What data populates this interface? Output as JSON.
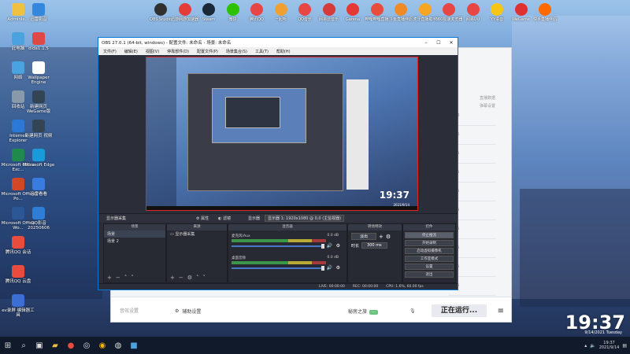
{
  "desktop": {
    "left_icons": [
      {
        "label": "Adminis...",
        "color": "#f0c040"
      },
      {
        "label": "此电脑",
        "color": "#4aa3df"
      },
      {
        "label": "网络",
        "color": "#4aa3df"
      },
      {
        "label": "回收站",
        "color": "#8899aa"
      },
      {
        "label": "Internet Explorer",
        "color": "#2b78d6"
      },
      {
        "label": "Microsoft Office Exc...",
        "color": "#1f8a4c"
      },
      {
        "label": "Microsoft Office Po...",
        "color": "#d24726"
      },
      {
        "label": "Microsoft Office Wo...",
        "color": "#2b5797"
      },
      {
        "label": "腾讯QQ 会话",
        "color": "#e94b3c"
      },
      {
        "label": "腾讯QQ 云盘",
        "color": "#e94b3c"
      },
      {
        "label": "ev录屏 编辑器工具",
        "color": "#3b6fd6"
      }
    ],
    "second_col_icons": [
      {
        "label": "迅雷影音",
        "color": "#3388dd"
      },
      {
        "label": "dida1.1.5",
        "color": "#e04848"
      },
      {
        "label": "Wallpaper Engine",
        "color": "#ffffff"
      },
      {
        "label": "新建网页 WeGame版",
        "color": "#334455"
      },
      {
        "label": "新建网页 视频",
        "color": "#334455"
      },
      {
        "label": "Microsoft Edge",
        "color": "#1a9ad8"
      },
      {
        "label": "迅雷看看",
        "color": "#3a7be0"
      },
      {
        "label": "QQ影音 20250606",
        "color": "#2e7dd7"
      }
    ],
    "top_icons": [
      {
        "label": "OBS Studio",
        "color": "#303030"
      },
      {
        "label": "迅游网游加速器",
        "color": "#e43b3b"
      },
      {
        "label": "Steam",
        "color": "#1b2838"
      },
      {
        "label": "微信",
        "color": "#2dc100"
      },
      {
        "label": "腾讯QQ",
        "color": "#e84545"
      },
      {
        "label": "一起听",
        "color": "#f0a030"
      },
      {
        "label": "QQ音乐",
        "color": "#e84545"
      },
      {
        "label": "网易云音乐",
        "color": "#d63a3a"
      },
      {
        "label": "Garena",
        "color": "#e53935"
      },
      {
        "label": "哔哩哔哩直播",
        "color": "#e94b3c"
      },
      {
        "label": "斗鱼直播伴侣",
        "color": "#f08a24"
      },
      {
        "label": "虎牙直播助手",
        "color": "#f6a623"
      },
      {
        "label": "360极速浏览器",
        "color": "#e84545"
      },
      {
        "label": "网易UU",
        "color": "#e84545"
      },
      {
        "label": "YY语音",
        "color": "#f5c518"
      },
      {
        "label": "WeGame",
        "color": "#e03131"
      },
      {
        "label": "快手直播伴侣",
        "color": "#ff6a00"
      }
    ]
  },
  "obs": {
    "title": "OBS 27.0.1 (64-bit, windows) - 配置文件: 未命名 - 场景: 未命名",
    "menu": [
      "文件(F)",
      "编辑(E)",
      "视图(V)",
      "停靠部件(D)",
      "配置文件(P)",
      "场景集合(S)",
      "工具(T)",
      "帮助(H)"
    ],
    "preview": {
      "clock": "19:37",
      "date": "2021/9/14"
    },
    "context_bar": {
      "scene_label": "显示器采集",
      "properties": "属性",
      "filters": "滤镜",
      "display_label": "显示器",
      "display_value": "显示器 1: 1920x1080 @ 0,0 (主监视器)"
    },
    "docks": {
      "scenes": {
        "header": "场景",
        "items": [
          "场景",
          "场景 2"
        ]
      },
      "sources": {
        "header": "来源",
        "items": [
          "显示器采集"
        ]
      },
      "mixer": {
        "header": "混音器",
        "tracks": [
          {
            "name": "麦克风/Aux",
            "db": "0.0 dB"
          },
          {
            "name": "桌面音频",
            "db": "0.0 dB"
          }
        ]
      },
      "transitions": {
        "header": "转场特效",
        "type": "淡出",
        "duration_label": "时长",
        "duration_value": "300 ms"
      },
      "controls": {
        "header": "控件",
        "buttons": [
          "停止推流",
          "开始录制",
          "启动虚拟摄像机",
          "工作室模式",
          "设置",
          "退出"
        ]
      }
    },
    "status": {
      "live": "LIVE: 00:00:00",
      "rec": "REC: 00:00:00",
      "cpu": "CPU: 1.6%, 60.00 fps"
    }
  },
  "bg_app": {
    "left_label": "音效设置",
    "audio_label": "辅助设置",
    "scene_label": "秘房之旅",
    "running": "正在运行...",
    "list_labels": [
      "直播数据",
      "弹幕设置"
    ],
    "times": [
      "09:08",
      "09:06",
      "09:05",
      "09:05",
      "09:05",
      "09:05",
      "09:05",
      "09:05",
      "09:05",
      "09:05"
    ]
  },
  "clock": {
    "time": "19:37",
    "date": "9/14/2021 Tuesday"
  },
  "taskbar": {
    "tray_time": "19:37",
    "tray_date": "2021/9/14"
  }
}
